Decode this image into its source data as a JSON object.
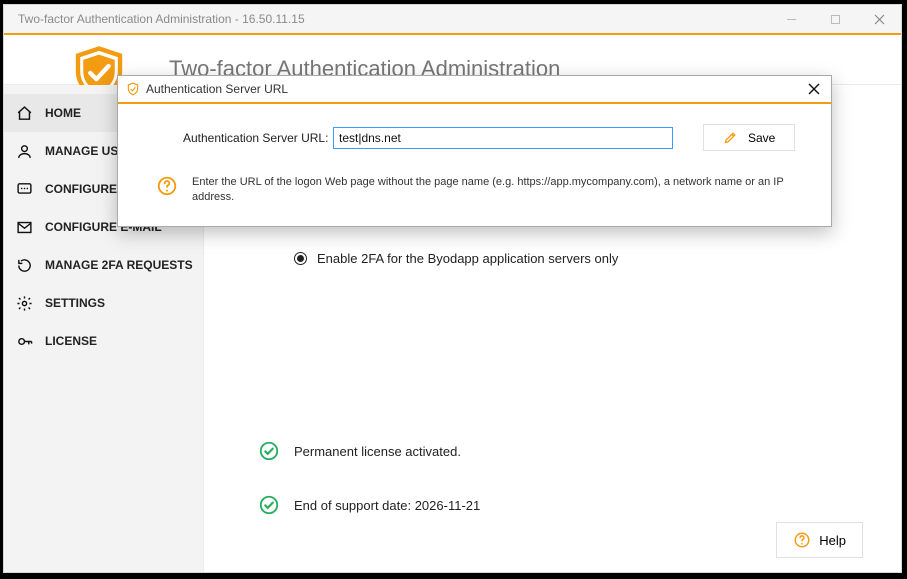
{
  "window": {
    "title": "Two-factor Authentication Administration - 16.50.11.15"
  },
  "header": {
    "title": "Two-factor Authentication Administration"
  },
  "sidebar": {
    "items": [
      {
        "label": "HOME"
      },
      {
        "label": "MANAGE USERS"
      },
      {
        "label": "CONFIGURE SMS"
      },
      {
        "label": "CONFIGURE E-MAIL"
      },
      {
        "label": "MANAGE 2FA REQUESTS"
      },
      {
        "label": "SETTINGS"
      },
      {
        "label": "LICENSE"
      }
    ]
  },
  "main": {
    "radio_label": "Enable 2FA for the Byodapp application servers only",
    "status1": "Permanent license activated.",
    "status2": "End of support date: 2026-11-21",
    "help_label": "Help"
  },
  "modal": {
    "title": "Authentication Server URL",
    "field_label": "Authentication Server URL:",
    "field_value": "test|dns.net",
    "save_label": "Save",
    "hint": "Enter the URL of the logon Web page without the page name (e.g. https://app.mycompany.com), a network name or an IP address."
  }
}
